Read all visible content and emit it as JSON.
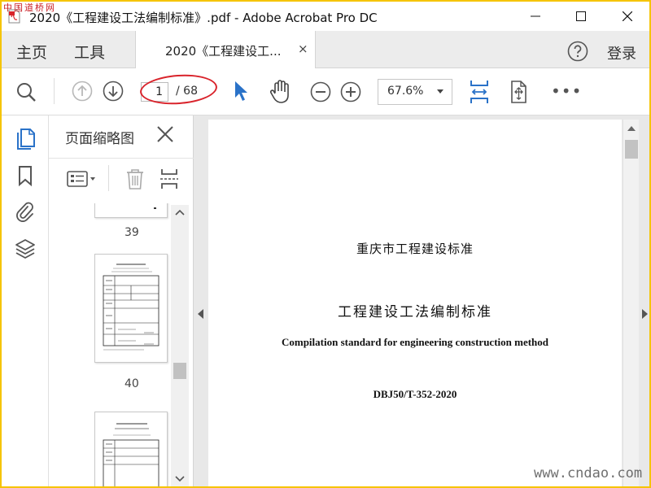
{
  "window": {
    "title": "2020《工程建设工法编制标准》.pdf - Adobe Acrobat Pro DC"
  },
  "tabs": {
    "home": "主页",
    "tools": "工具",
    "document": "2020《工程建设工...",
    "close": "×",
    "login": "登录"
  },
  "toolbar": {
    "current_page": "1",
    "total_pages": "/ 68",
    "zoom": "67.6%",
    "more": "•••"
  },
  "thumbnails_panel": {
    "title": "页面缩略图",
    "pages": [
      {
        "label": "39"
      },
      {
        "label": "40"
      }
    ]
  },
  "document_page": {
    "org": "重庆市工程建设标准",
    "title": "工程建设工法编制标准",
    "english_title": "Compilation standard for engineering construction method",
    "code": "DBJ50/T-352-2020"
  },
  "watermarks": {
    "top_left": "中国道桥网",
    "bottom_right": "www.cndao.com"
  },
  "colors": {
    "accent_blue": "#2a72c8",
    "highlight_oval": "#d9232b",
    "frame_border": "#f5c400"
  }
}
